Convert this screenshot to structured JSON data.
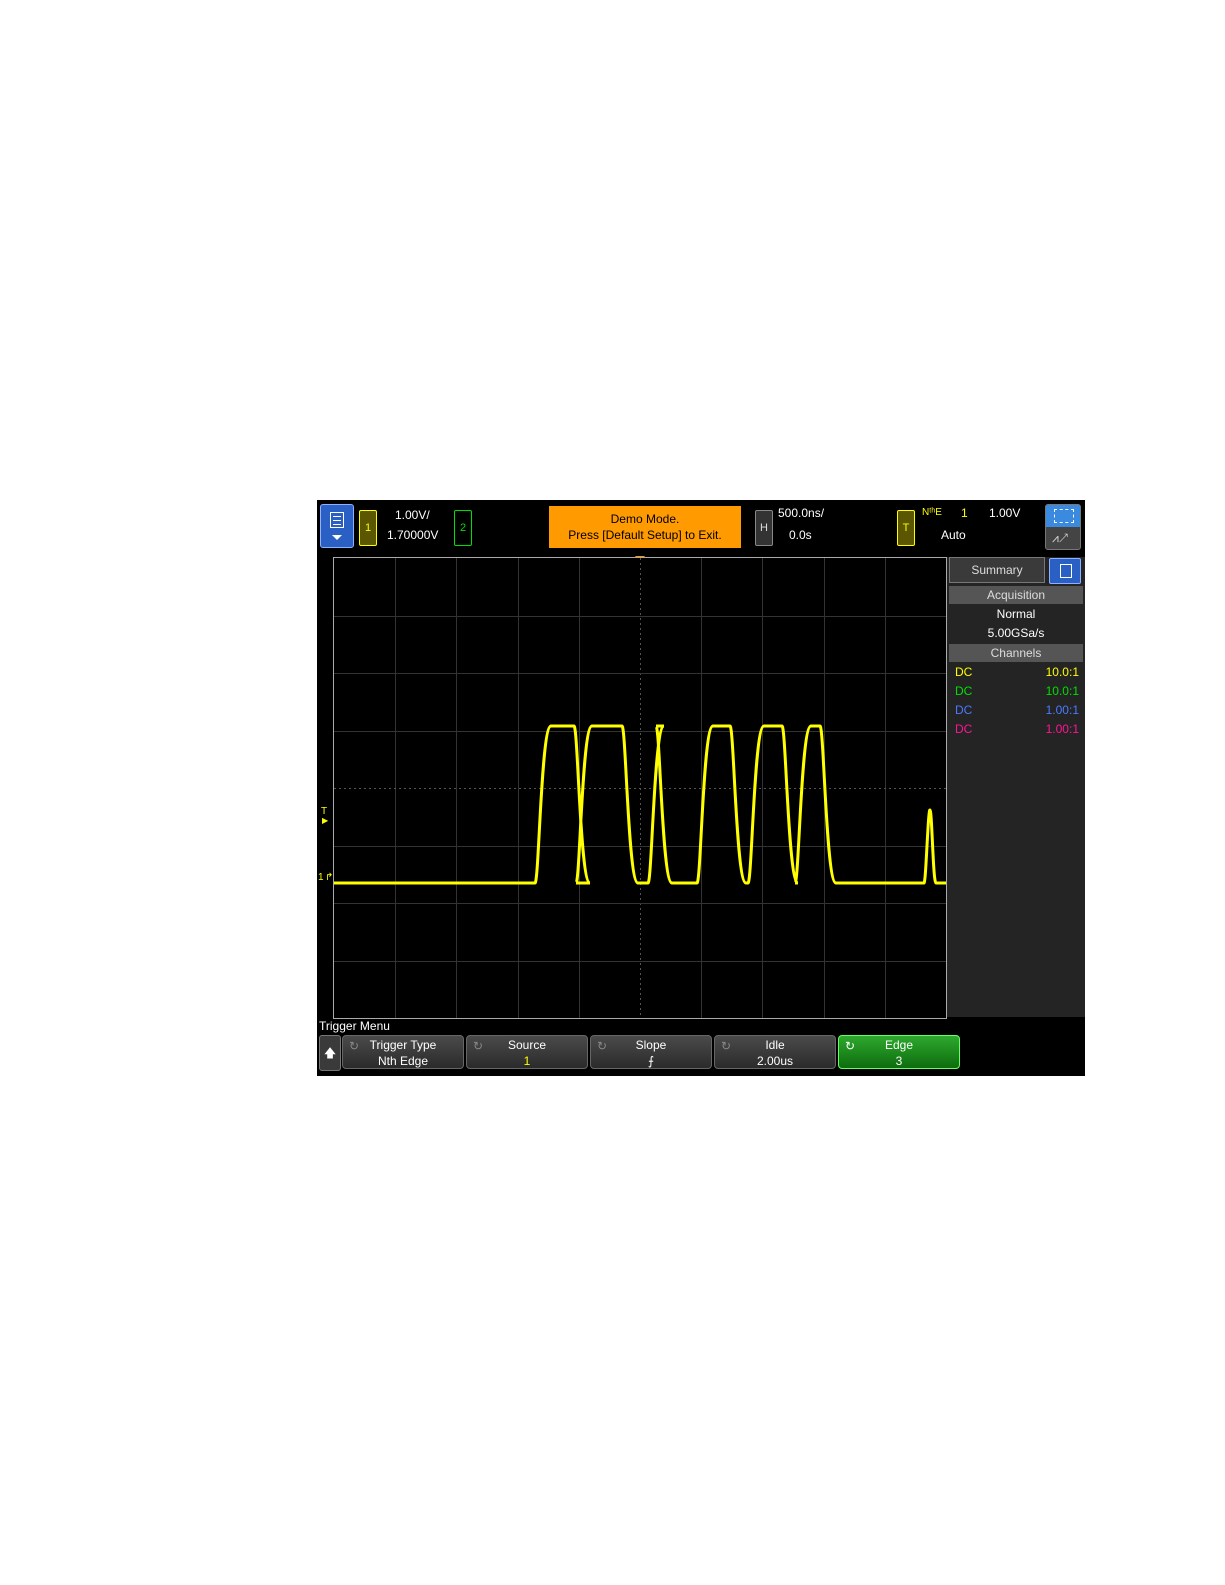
{
  "top_bar": {
    "ch1_label": "1",
    "ch1_scale": "1.00V/",
    "ch1_offset": "1.70000V",
    "ch2_label": "2",
    "demo_line1": "Demo Mode.",
    "demo_line2": "Press [Default Setup] to Exit.",
    "horiz_label": "H",
    "horiz_scale": "500.0ns/",
    "horiz_delay": "0.0s",
    "trig_label": "T",
    "trig_type": "NᵗʰE",
    "trig_source": "1",
    "trig_level": "1.00V",
    "trig_mode": "Auto"
  },
  "screen": {
    "trigger_marker": "T",
    "ground_marker": "1"
  },
  "side_panel": {
    "tab": "Summary",
    "acquisition_header": "Acquisition",
    "acq_mode": "Normal",
    "sample_rate": "5.00GSa/s",
    "channels_header": "Channels",
    "channels": [
      {
        "coupling": "DC",
        "probe": "10.0:1",
        "color": "#ffff00"
      },
      {
        "coupling": "DC",
        "probe": "10.0:1",
        "color": "#00e000"
      },
      {
        "coupling": "DC",
        "probe": "1.00:1",
        "color": "#4a7aff"
      },
      {
        "coupling": "DC",
        "probe": "1.00:1",
        "color": "#ff1493"
      }
    ]
  },
  "softkeys": {
    "menu_title": "Trigger Menu",
    "keys": [
      {
        "label": "Trigger Type",
        "value": "Nth Edge"
      },
      {
        "label": "Source",
        "value": "1"
      },
      {
        "label": "Slope",
        "value": "⨍"
      },
      {
        "label": "Idle",
        "value": "2.00us"
      },
      {
        "label": "Edge",
        "value": "3"
      }
    ]
  },
  "colors": {
    "ch1": "#ffff00",
    "ch2": "#00e000",
    "demo": "#ff9a00",
    "active_key": "#1a8a1a"
  }
}
